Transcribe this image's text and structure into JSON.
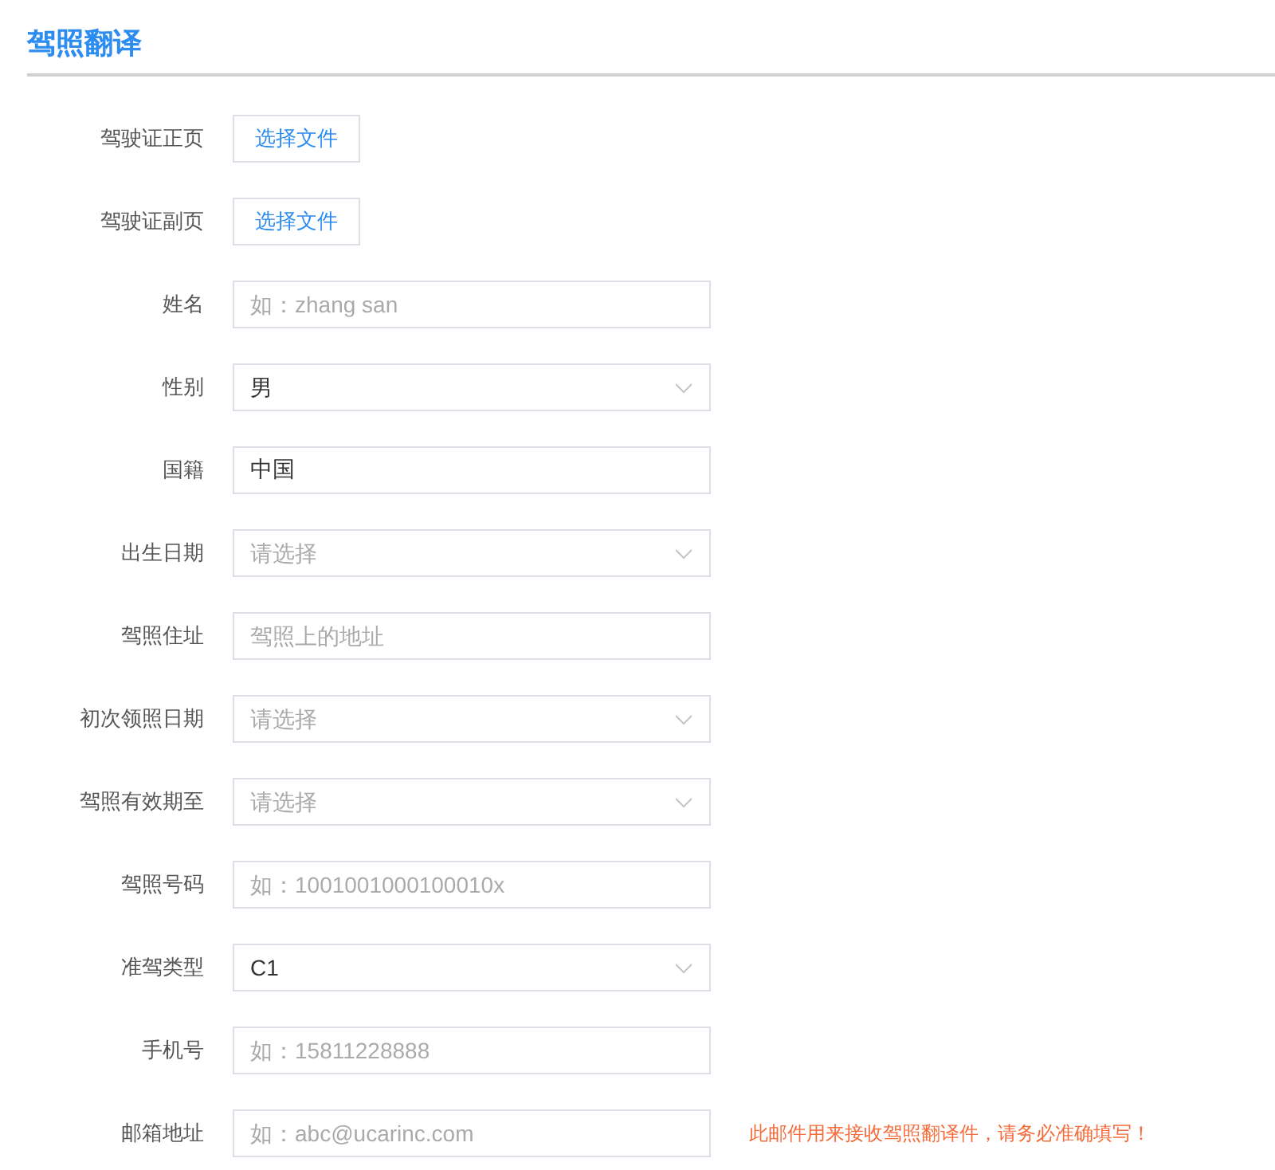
{
  "title": "驾照翻译",
  "fields": [
    {
      "label": "驾驶证正页",
      "kind": "file",
      "button": "选择文件"
    },
    {
      "label": "驾驶证副页",
      "kind": "file",
      "button": "选择文件"
    },
    {
      "label": "姓名",
      "kind": "text",
      "placeholder": "如：zhang san"
    },
    {
      "label": "性别",
      "kind": "select",
      "value": "男"
    },
    {
      "label": "国籍",
      "kind": "text",
      "value": "中国"
    },
    {
      "label": "出生日期",
      "kind": "select",
      "placeholder": "请选择"
    },
    {
      "label": "驾照住址",
      "kind": "text",
      "placeholder": "驾照上的地址"
    },
    {
      "label": "初次领照日期",
      "kind": "select",
      "placeholder": "请选择"
    },
    {
      "label": "驾照有效期至",
      "kind": "select",
      "placeholder": "请选择"
    },
    {
      "label": "驾照号码",
      "kind": "text",
      "placeholder": "如：1001001000100010x"
    },
    {
      "label": "准驾类型",
      "kind": "select",
      "value": "C1"
    },
    {
      "label": "手机号",
      "kind": "text",
      "placeholder": "如：15811228888"
    },
    {
      "label": "邮箱地址",
      "kind": "text",
      "placeholder": "如：abc@ucarinc.com",
      "note": "此邮件用来接收驾照翻译件，请务必准确填写！"
    }
  ]
}
